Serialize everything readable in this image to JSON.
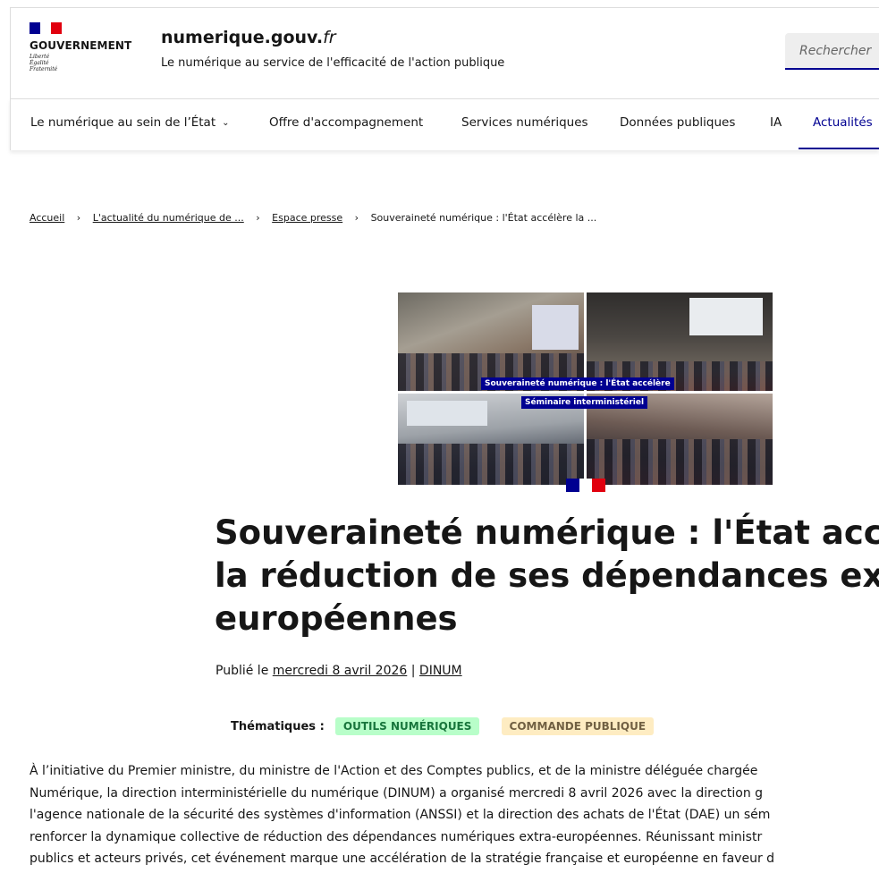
{
  "header": {
    "logo_text": "GOUVERNEMENT",
    "motto": [
      "Liberté",
      "Égalité",
      "Fraternité"
    ],
    "site_name_main": "numerique.gouv.",
    "site_name_suffix": "fr",
    "tagline": "Le numérique au service de l'efficacité de l'action publique",
    "search_placeholder": "Rechercher"
  },
  "nav": {
    "items": [
      {
        "label": "Le numérique au sein de l’État"
      },
      {
        "label": "Offre d'accompagnement"
      },
      {
        "label": "Services numériques"
      },
      {
        "label": "Données publiques"
      },
      {
        "label": "IA"
      },
      {
        "label": "Actualités"
      }
    ],
    "dropdown_icon": "chevron-down-icon",
    "active": "Actualités"
  },
  "breadcrumb": {
    "items": [
      "Accueil",
      "L'actualité du numérique de ...",
      "Espace presse",
      "Souveraineté numérique : l'État accélère la ..."
    ]
  },
  "hero": {
    "caption_1": "Souveraineté numérique : l'État accélère",
    "caption_2": "Séminaire interministériel"
  },
  "article": {
    "title_lines": [
      "Souveraineté numérique : l'État accél",
      "la réduction de ses dépendances extr",
      "européennes"
    ],
    "published_prefix": "Publié le ",
    "date": "mercredi 8 avril 2026",
    "separator": " | ",
    "author": "DINUM",
    "themes_label": "Thématiques :",
    "tags": [
      "OUTILS NUMÉRIQUES",
      "COMMANDE PUBLIQUE"
    ],
    "body_lines": [
      "À l’initiative du Premier ministre, du ministre de l'Action et des Comptes publics, et de la ministre déléguée chargée",
      "Numérique, la direction interministérielle du numérique (DINUM) a organisé mercredi 8 avril 2026 avec la direction g",
      "l'agence nationale de la sécurité des systèmes d'information (ANSSI) et la direction des achats de l'État (DAE) un sém",
      "renforcer la dynamique collective de réduction des dépendances numériques extra-européennes. Réunissant ministr",
      "publics et acteurs privés, cet événement marque une accélération de la stratégie française et européenne en faveur d"
    ]
  },
  "colors": {
    "primary_blue": "#000091",
    "flag_red": "#e1000f",
    "tag_green_bg": "#b8fec9",
    "tag_green_text": "#18753c",
    "tag_yellow_bg": "#feecc2",
    "tag_yellow_text": "#716043"
  }
}
